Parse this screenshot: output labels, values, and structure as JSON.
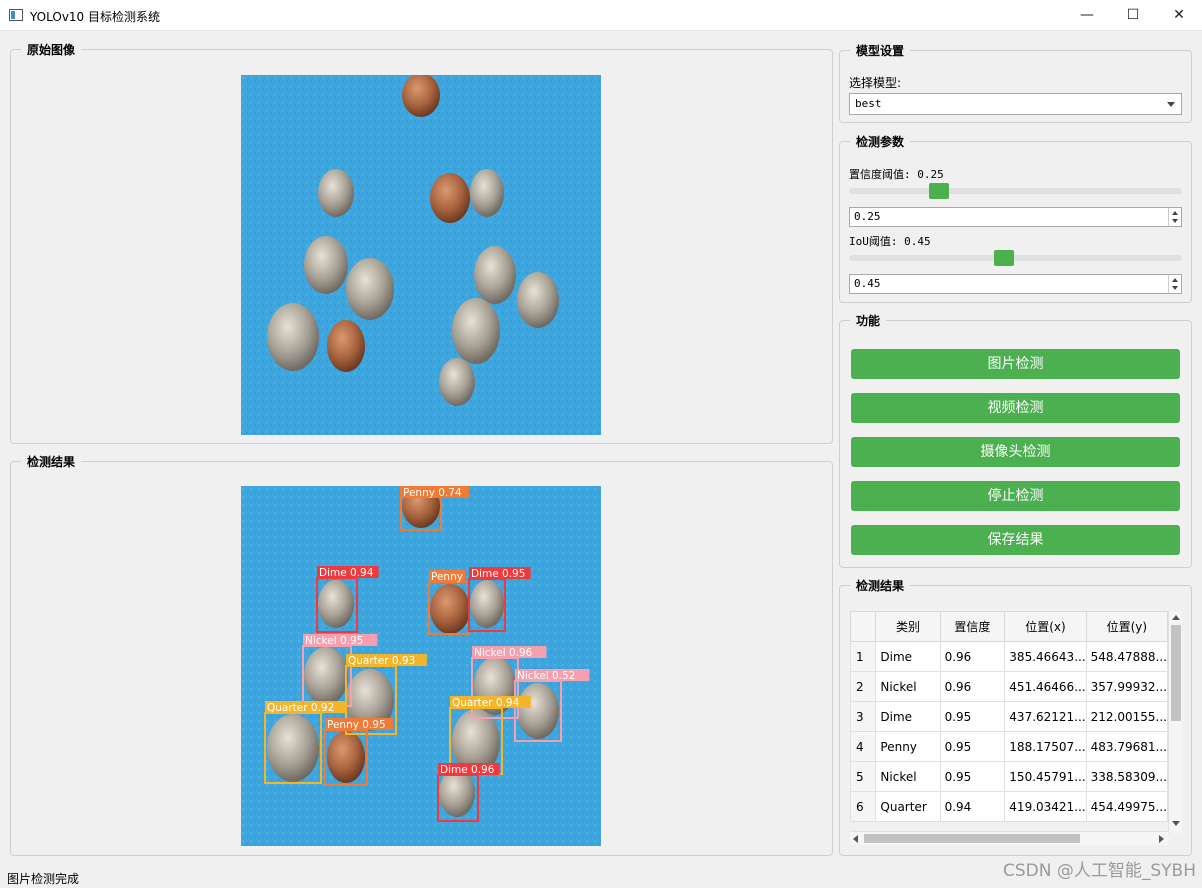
{
  "window": {
    "title": "YOLOv10 目标检测系统",
    "minimize": "—",
    "maximize": "☐",
    "close": "✕"
  },
  "original_panel": {
    "title": "原始图像"
  },
  "result_panel": {
    "title": "检测结果"
  },
  "model_settings": {
    "title": "模型设置",
    "select_label": "选择模型:",
    "selected_model": "best"
  },
  "detect_params": {
    "title": "检测参数",
    "conf_label": "置信度阈值: 0.25",
    "conf_value": "0.25",
    "conf_fraction": 0.25,
    "iou_label": "IoU阈值: 0.45",
    "iou_value": "0.45",
    "iou_fraction": 0.45
  },
  "functions": {
    "title": "功能",
    "buttons": [
      "图片检测",
      "视频检测",
      "摄像头检测",
      "停止检测",
      "保存结果"
    ]
  },
  "results_table": {
    "title": "检测结果",
    "headers": [
      "类别",
      "置信度",
      "位置(x)",
      "位置(y)"
    ],
    "rows": [
      [
        "1",
        "Dime",
        "0.96",
        "385.46643...",
        "548.47888..."
      ],
      [
        "2",
        "Nickel",
        "0.96",
        "451.46466...",
        "357.99932..."
      ],
      [
        "3",
        "Dime",
        "0.95",
        "437.62121...",
        "212.00155..."
      ],
      [
        "4",
        "Penny",
        "0.95",
        "188.17507...",
        "483.79681..."
      ],
      [
        "5",
        "Nickel",
        "0.95",
        "150.45791...",
        "338.58309..."
      ],
      [
        "6",
        "Quarter",
        "0.94",
        "419.03421...",
        "454.49975..."
      ]
    ]
  },
  "detections": [
    {
      "label": "Penny 0.74",
      "color": "#f07a36"
    },
    {
      "label": "Dime 0.94",
      "color": "#f0393d"
    },
    {
      "label": "Penny",
      "color": "#f07a36"
    },
    {
      "label": "Dime 0.95",
      "color": "#f0393d"
    },
    {
      "label": "Nickel 0.95",
      "color": "#f5a0ae"
    },
    {
      "label": "Quarter 0.93",
      "color": "#f5b52a"
    },
    {
      "label": "Nickel 0.96",
      "color": "#f5a0ae"
    },
    {
      "label": "Nickel 0.52",
      "color": "#f5a0ae"
    },
    {
      "label": "Quarter 0.92",
      "color": "#f5b52a"
    },
    {
      "label": "Quarter 0.94",
      "color": "#f5b52a"
    },
    {
      "label": "Penny 0.95",
      "color": "#f07a36"
    },
    {
      "label": "Dime 0.96",
      "color": "#f0393d"
    }
  ],
  "status": {
    "text": "图片检测完成"
  },
  "watermark": "CSDN @人工智能_SYBH",
  "colors": {
    "accent": "#4caf50",
    "image_bg": "#3da6de"
  }
}
